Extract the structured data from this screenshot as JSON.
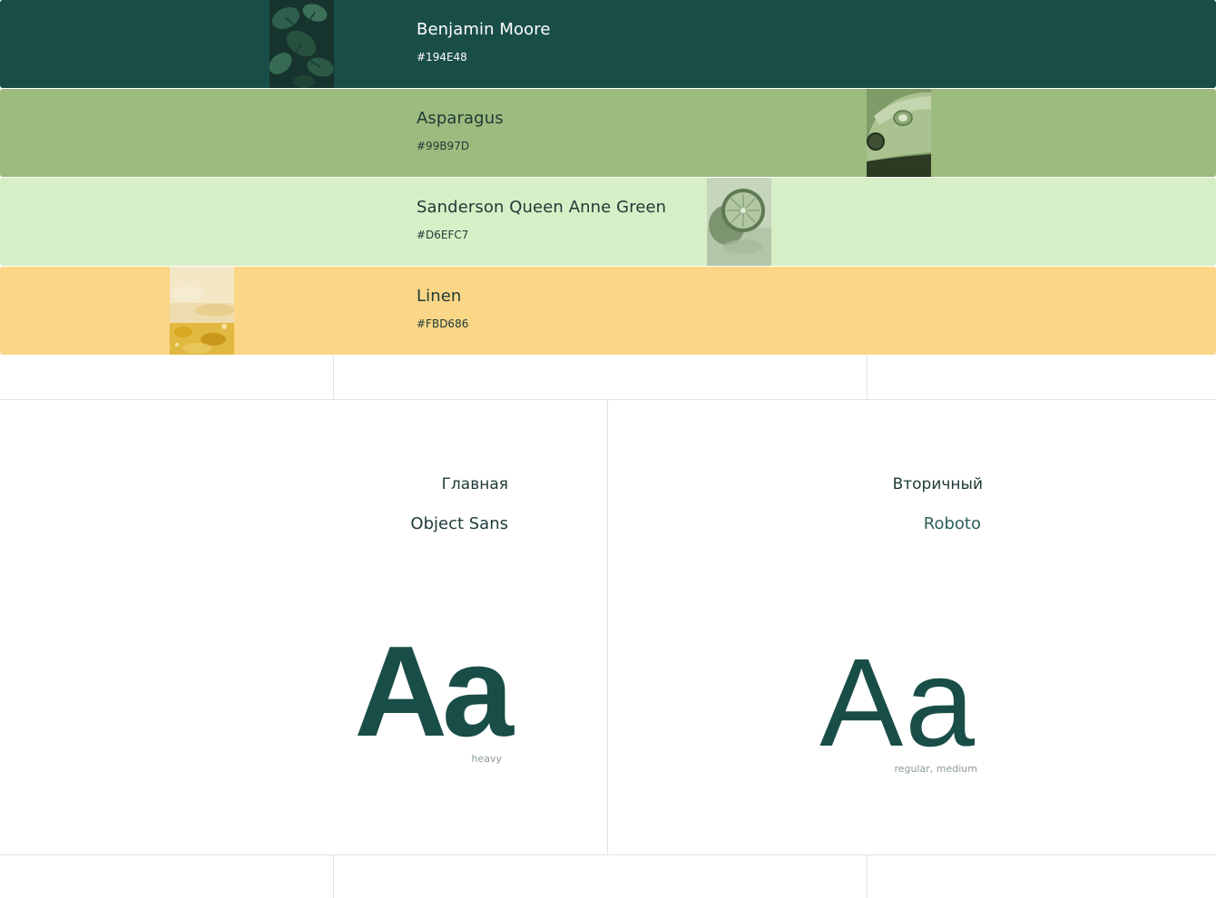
{
  "palette": [
    {
      "name": "Benjamin Moore",
      "hex": "#194E48",
      "color": "#194E48",
      "text_color": "#ffffff",
      "photo_icon": "leaf-photo"
    },
    {
      "name": "Asparagus",
      "hex": "#99B97D",
      "color": "#9DBB7F",
      "text_color": "#1d3a36",
      "photo_icon": "car-photo"
    },
    {
      "name": "Sanderson Queen Anne Green",
      "hex": "#D6EFC7",
      "color": "#D6EFC7",
      "text_color": "#1d3a36",
      "photo_icon": "lime-photo"
    },
    {
      "name": "Linen",
      "hex": "#FBD686",
      "color": "#FBD686",
      "text_color": "#1d3a36",
      "photo_icon": "texture-photo"
    }
  ],
  "typography": {
    "primary": {
      "role": "Главная",
      "family": "Object Sans",
      "sample": "Aa",
      "weights": "heavy",
      "family_color": "#1d3a36"
    },
    "secondary": {
      "role": "Вторичный",
      "family": "Roboto",
      "sample": "Aa",
      "weights": "regular, medium",
      "family_color": "#2d5f57"
    }
  }
}
